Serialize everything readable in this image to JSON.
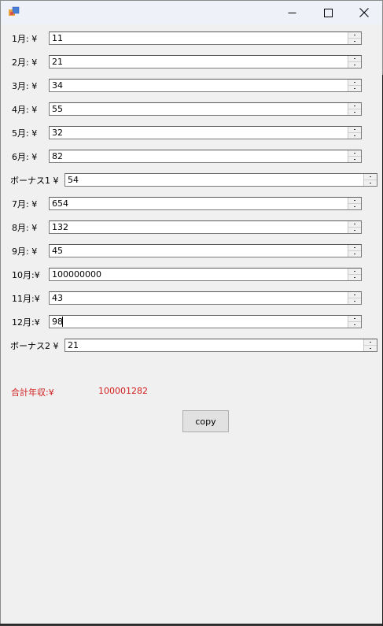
{
  "window": {
    "minimize_glyph": "—",
    "maximize_glyph": "☐",
    "close_glyph": "✕"
  },
  "fields": [
    {
      "label": "1月: ¥",
      "value": "11"
    },
    {
      "label": "2月: ¥",
      "value": "21"
    },
    {
      "label": "3月: ¥",
      "value": "34"
    },
    {
      "label": "4月: ¥",
      "value": "55"
    },
    {
      "label": "5月: ¥",
      "value": "32"
    },
    {
      "label": "6月: ¥",
      "value": "82"
    },
    {
      "label": "ボーナス1 ¥",
      "value": "54"
    },
    {
      "label": "7月: ¥",
      "value": "654"
    },
    {
      "label": "8月: ¥",
      "value": "132"
    },
    {
      "label": "9月: ¥",
      "value": "45"
    },
    {
      "label": "10月:¥",
      "value": "100000000"
    },
    {
      "label": "11月:¥",
      "value": "43"
    },
    {
      "label": "12月:¥",
      "value": "98"
    },
    {
      "label": "ボーナス2 ¥",
      "value": "21"
    }
  ],
  "total": {
    "label": "合計年収:¥",
    "value": "100001282",
    "color": "#d21e1e"
  },
  "copy_button": {
    "label": "copy"
  }
}
